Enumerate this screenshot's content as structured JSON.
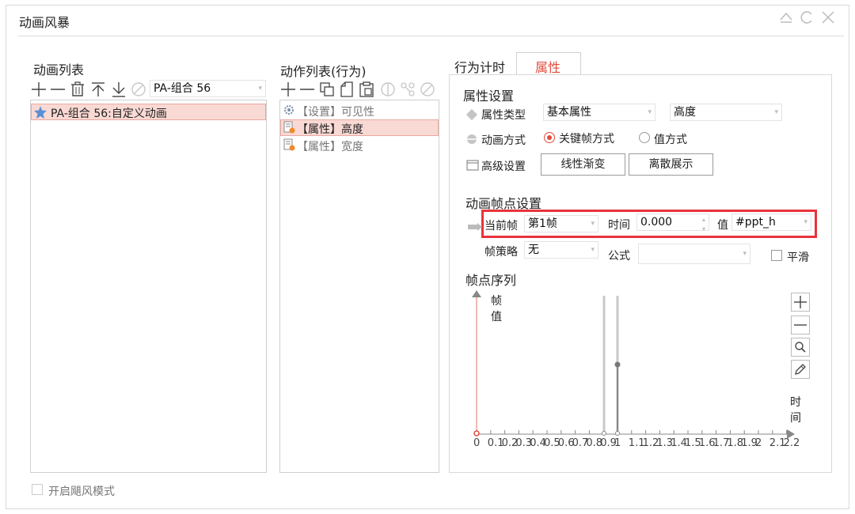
{
  "window": {
    "title": "动画风暴",
    "buttons": [
      "restore-icon",
      "refresh-icon",
      "close-icon"
    ]
  },
  "anim_list": {
    "label": "动画列表",
    "combo_value": "PA-组合 56",
    "items": [
      {
        "label": "PA-组合 56:自定义动画",
        "selected": true
      }
    ]
  },
  "action_list": {
    "label": "动作列表(行为)",
    "items": [
      {
        "label": "【设置】可见性",
        "selected": false
      },
      {
        "label": "【属性】高度",
        "selected": true
      },
      {
        "label": "【属性】宽度",
        "selected": false
      }
    ]
  },
  "tabs": [
    {
      "label": "行为计时",
      "active": false
    },
    {
      "label": "属性",
      "active": true
    }
  ],
  "properties": {
    "section_title": "属性设置",
    "type_label": "属性类型",
    "type_value": "基本属性",
    "type_value2": "高度",
    "mode_label": "动画方式",
    "mode_options": [
      "关键帧方式",
      "值方式"
    ],
    "mode_selected": 0,
    "advanced_label": "高级设置",
    "btn_linear": "线性渐变",
    "btn_discrete": "离散展示"
  },
  "frames": {
    "section_title": "动画帧点设置",
    "current_label": "当前帧",
    "current_value": "第1帧",
    "time_label": "时间",
    "time_value": "0.000",
    "value_label": "值",
    "value_value": "#ppt_h",
    "strategy_label": "帧策略",
    "strategy_value": "无",
    "formula_label": "公式",
    "formula_value": "",
    "smooth_label": "平滑",
    "sequence_title": "帧点序列"
  },
  "graph": {
    "y_label_1": "帧",
    "y_label_2": "值",
    "x_label_1": "时",
    "x_label_2": "间",
    "tick_labels": [
      "0",
      "0.1",
      "0.2",
      "0.3",
      "0.4",
      "0.5",
      "0.6",
      "0.7",
      "0.8",
      "0.9",
      "1",
      "1.1",
      "1.2",
      "1.3",
      "1.4",
      "1.5",
      "1.6",
      "1.7",
      "1.8",
      "1.9",
      "2",
      "2.1",
      "2.2"
    ]
  },
  "footer": {
    "storm_mode_label": "开启飓风模式"
  },
  "colors": {
    "accent": "#e04b3a",
    "selection_bg": "#f9d9d4",
    "highlight_box": "#e8333a"
  }
}
